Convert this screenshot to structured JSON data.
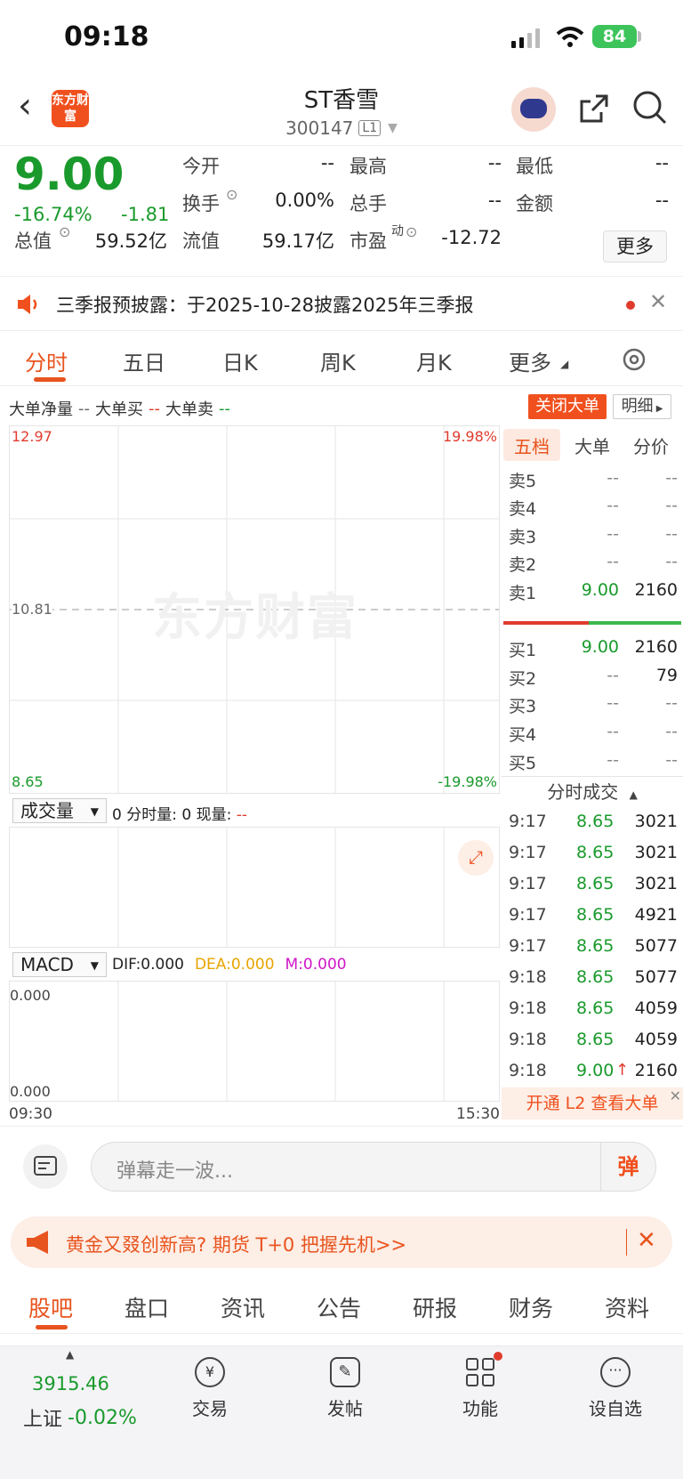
{
  "status": {
    "time": "09:18",
    "battery": "84"
  },
  "header": {
    "logo": "东方财富",
    "stock_name": "ST香雪",
    "stock_code": "300147",
    "level": "L1"
  },
  "quote": {
    "price": "9.00",
    "pct": "-16.74%",
    "change": "-1.81",
    "open_label": "今开",
    "open": "--",
    "high_label": "最高",
    "high": "--",
    "low_label": "最低",
    "low": "--",
    "turnover_label": "换手",
    "turnover": "0.00%",
    "volume_label": "总手",
    "volume": "--",
    "amount_label": "金额",
    "amount": "--",
    "mktcap_label": "总值",
    "mktcap": "59.52亿",
    "float_label": "流值",
    "float": "59.17亿",
    "pe_label": "市盈",
    "pe_sup": "动",
    "pe": "-12.72",
    "more": "更多"
  },
  "notice": {
    "text": "三季报预披露：于2025-10-28披露2025年三季报"
  },
  "period_tabs": [
    "分时",
    "五日",
    "日K",
    "周K",
    "月K",
    "更多"
  ],
  "bigbar": {
    "net_label": "大单净量",
    "net": "--",
    "buy_label": "大单买",
    "buy": "--",
    "sell_label": "大单卖",
    "sell": "--",
    "close_btn": "关闭大单",
    "detail_btn": "明细"
  },
  "chart": {
    "high": "12.97",
    "mid": "10.81",
    "low": "8.65",
    "high_pct": "19.98%",
    "low_pct": "-19.98%",
    "watermark": "东方财富",
    "vol_select": "成交量",
    "vol_text": "0 分时量: 0 现量:",
    "vol_cur": "--",
    "macd_select": "MACD",
    "dif": "DIF:0.000",
    "dea": "DEA:0.000",
    "m": "M:0.000",
    "macd_top": "0.000",
    "macd_bottom": "0.000",
    "time_start": "09:30",
    "time_end": "15:30"
  },
  "book": {
    "tabs": [
      "五档",
      "大单",
      "分价"
    ],
    "sell": [
      {
        "label": "卖5",
        "price": "--",
        "vol": "--"
      },
      {
        "label": "卖4",
        "price": "--",
        "vol": "--"
      },
      {
        "label": "卖3",
        "price": "--",
        "vol": "--"
      },
      {
        "label": "卖2",
        "price": "--",
        "vol": "--"
      },
      {
        "label": "卖1",
        "price": "9.00",
        "vol": "2160"
      }
    ],
    "buy": [
      {
        "label": "买1",
        "price": "9.00",
        "vol": "2160"
      },
      {
        "label": "买2",
        "price": "--",
        "vol": "79"
      },
      {
        "label": "买3",
        "price": "--",
        "vol": "--"
      },
      {
        "label": "买4",
        "price": "--",
        "vol": "--"
      },
      {
        "label": "买5",
        "price": "--",
        "vol": "--"
      }
    ],
    "ticks_title": "分时成交",
    "ticks": [
      {
        "t": "9:17",
        "p": "8.65",
        "v": "3021"
      },
      {
        "t": "9:17",
        "p": "8.65",
        "v": "3021"
      },
      {
        "t": "9:17",
        "p": "8.65",
        "v": "3021"
      },
      {
        "t": "9:17",
        "p": "8.65",
        "v": "4921"
      },
      {
        "t": "9:17",
        "p": "8.65",
        "v": "5077"
      },
      {
        "t": "9:18",
        "p": "8.65",
        "v": "5077"
      },
      {
        "t": "9:18",
        "p": "8.65",
        "v": "4059"
      },
      {
        "t": "9:18",
        "p": "8.65",
        "v": "4059"
      },
      {
        "t": "9:18",
        "p": "9.00",
        "v": "2160"
      }
    ],
    "l2_banner": "开通 L2 查看大单"
  },
  "comment": {
    "placeholder": "弹幕走一波...",
    "danmu": "弹"
  },
  "ad": {
    "text": "黄金又叕创新高? 期货 T+0 把握先机>>"
  },
  "bottom_tabs": [
    "股吧",
    "盘口",
    "资讯",
    "公告",
    "研报",
    "财务",
    "资料"
  ],
  "tabbar": {
    "index_value": "3915.46",
    "index_name": "上证",
    "index_pct": "-0.02%",
    "items": [
      "交易",
      "发帖",
      "功能",
      "设自选"
    ]
  },
  "colors": {
    "accent": "#e8541e",
    "down": "#1a9a2c",
    "up": "#e03c2e"
  }
}
